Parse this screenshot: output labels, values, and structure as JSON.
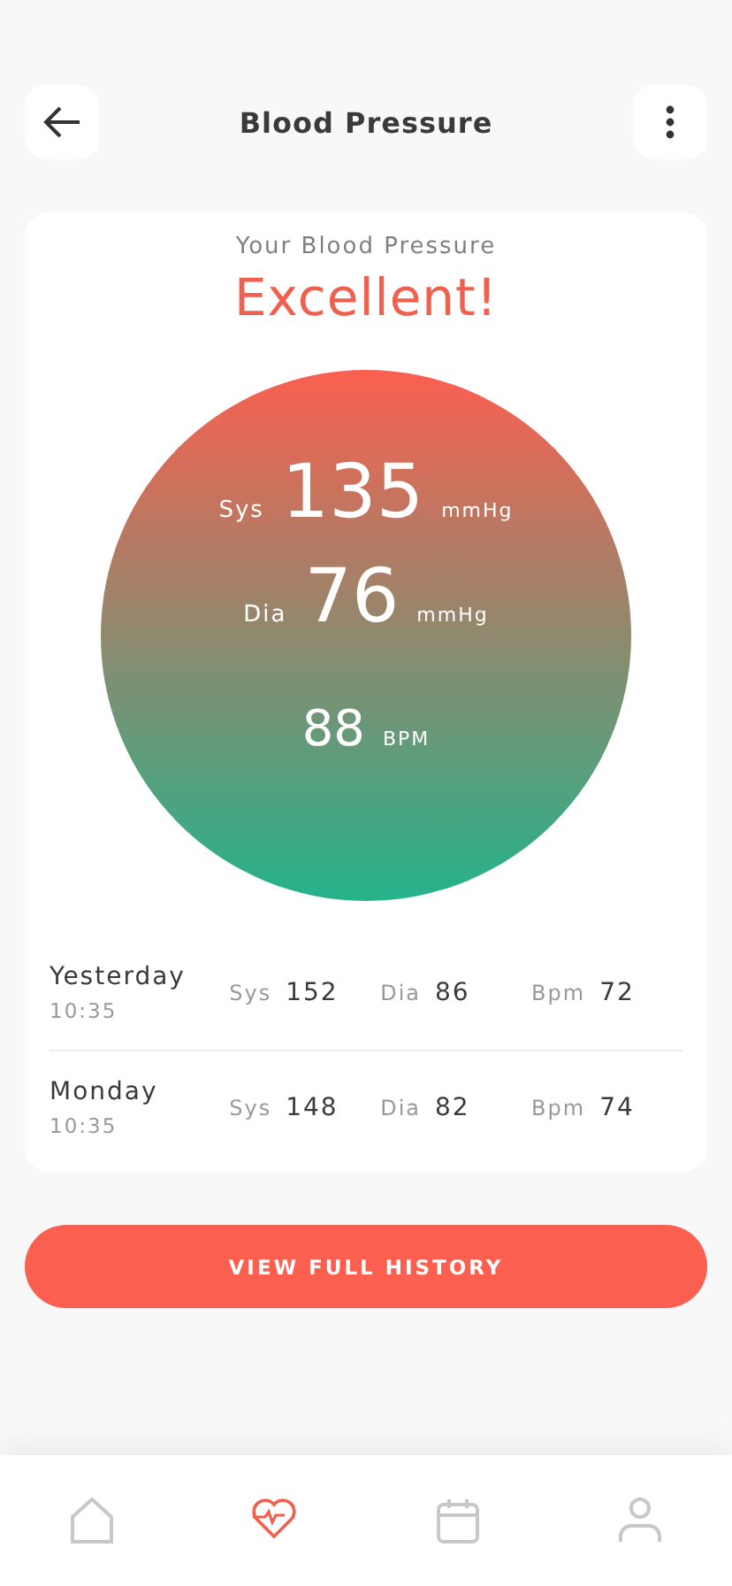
{
  "header": {
    "title": "Blood Pressure"
  },
  "card": {
    "subtitle": "Your Blood Pressure",
    "status": "Excellent!",
    "readings": [
      {
        "kind": "sys",
        "label": "Sys",
        "value": "135",
        "unit": "mmHg"
      },
      {
        "kind": "dia",
        "label": "Dia",
        "value": "76",
        "unit": "mmHg"
      },
      {
        "kind": "bpm",
        "value": "88",
        "unit": "BPM"
      }
    ],
    "history": [
      {
        "day": "Yesterday",
        "time": "10:35",
        "sys_label": "Sys",
        "sys": "152",
        "dia_label": "Dia",
        "dia": "86",
        "bpm_label": "Bpm",
        "bpm": "72"
      },
      {
        "day": "Monday",
        "time": "10:35",
        "sys_label": "Sys",
        "sys": "148",
        "dia_label": "Dia",
        "dia": "82",
        "bpm_label": "Bpm",
        "bpm": "74"
      }
    ]
  },
  "history_button": "VIEW FULL HISTORY",
  "nav": [
    {
      "kind": "home",
      "selected": false
    },
    {
      "kind": "heart",
      "selected": true
    },
    {
      "kind": "calendar",
      "selected": false
    },
    {
      "kind": "profile",
      "selected": false
    }
  ]
}
